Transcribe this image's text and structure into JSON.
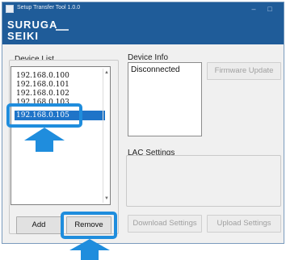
{
  "window": {
    "title": "Setup Transfer Tool 1.0.0",
    "minimize_glyph": "–",
    "maximize_glyph": "□"
  },
  "logo": {
    "line1": "SURUGA",
    "line2": "SEIKI"
  },
  "device_list": {
    "label": "Device List",
    "items": [
      "192.168.0.100",
      "192.168.0.101",
      "192.168.0.102",
      "192.168.0.103"
    ],
    "selected_item": "192.168.0.105"
  },
  "device_info": {
    "label": "Device Info",
    "status": "Disconnected",
    "firmware_button": "Firmware Update"
  },
  "lac_settings": {
    "label": "LAC Settings",
    "download_button": "Download Settings",
    "upload_button": "Upload Settings"
  },
  "actions": {
    "add_button": "Add",
    "remove_button": "Remove"
  },
  "colors": {
    "title_bar": "#1f5c99",
    "highlight": "#1f8ddd",
    "selection": "#1f74c8"
  }
}
